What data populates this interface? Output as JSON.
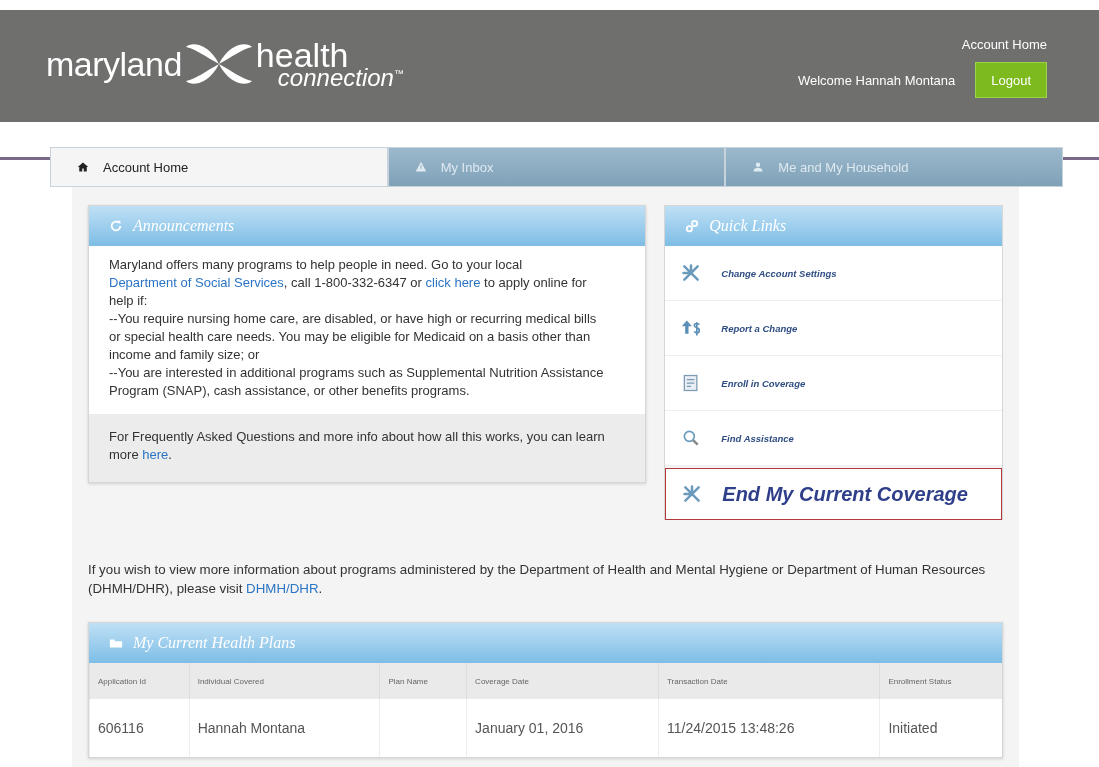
{
  "header": {
    "logo_word_1": "maryland",
    "logo_word_2": "health",
    "logo_word_3": "connection",
    "logo_mark": "™",
    "account_home_link": "Account Home",
    "welcome": "Welcome Hannah Montana",
    "logout_button": "Logout"
  },
  "tabs": [
    {
      "label": "Account Home",
      "kind": "home",
      "selected": true
    },
    {
      "label": "My Inbox",
      "kind": "warning",
      "selected": false
    },
    {
      "label": "Me and My Household",
      "kind": "person",
      "selected": false
    }
  ],
  "announcements": {
    "title": "Announcements",
    "paragraphs": [
      [
        {
          "kind": "text",
          "text": "Maryland offers many programs to help people in need. Go to your local "
        },
        {
          "kind": "link",
          "text": "Department of Social Services"
        },
        {
          "kind": "text",
          "text": ", call 1-800-332-6347 or "
        },
        {
          "kind": "link",
          "text": "click here"
        },
        {
          "kind": "text",
          "text": " to apply online for help if:"
        }
      ],
      [
        {
          "kind": "text",
          "text": "--You require nursing home care, are disabled, or have high or recurring medical bills or special health care needs. You may be eligible for Medicaid on a basis other than income and family size; or"
        }
      ],
      [
        {
          "kind": "text",
          "text": "--You are interested in additional programs such as Supplemental Nutrition Assistance Program (SNAP), cash assistance, or other benefits programs."
        }
      ]
    ],
    "footer": [
      {
        "kind": "text",
        "text": "For Frequently Asked Questions and more info about how all this works, you can learn more "
      },
      {
        "kind": "link",
        "text": "here"
      },
      {
        "kind": "text",
        "text": "."
      }
    ]
  },
  "quick_links": {
    "title": "Quick Links",
    "items": [
      {
        "label": "Change Account Settings",
        "kind": "settings",
        "highlighted": false
      },
      {
        "label": "Report a Change",
        "kind": "report",
        "highlighted": false
      },
      {
        "label": "Enroll in Coverage",
        "kind": "enroll",
        "highlighted": false
      },
      {
        "label": "Find Assistance",
        "kind": "find",
        "highlighted": false
      },
      {
        "label": "End My Current Coverage",
        "kind": "settings",
        "highlighted": true
      }
    ]
  },
  "info": [
    {
      "kind": "text",
      "text": "If you wish to view more information about programs administered by the Department of Health and Mental Hygiene or Department of Human Resources (DHMH/DHR), please visit "
    },
    {
      "kind": "link",
      "text": "DHMH/DHR"
    },
    {
      "kind": "text",
      "text": "."
    }
  ],
  "health_plans": {
    "title": "My Current Health Plans",
    "columns": [
      "Application Id",
      "Individual Covered",
      "Plan Name",
      "Coverage Date",
      "Transaction Date",
      "Enrollment Status"
    ],
    "rows": [
      [
        "606116",
        "Hannah  Montana",
        "",
        "January 01, 2016",
        "11/24/2015 13:48:26",
        "Initiated"
      ]
    ]
  }
}
